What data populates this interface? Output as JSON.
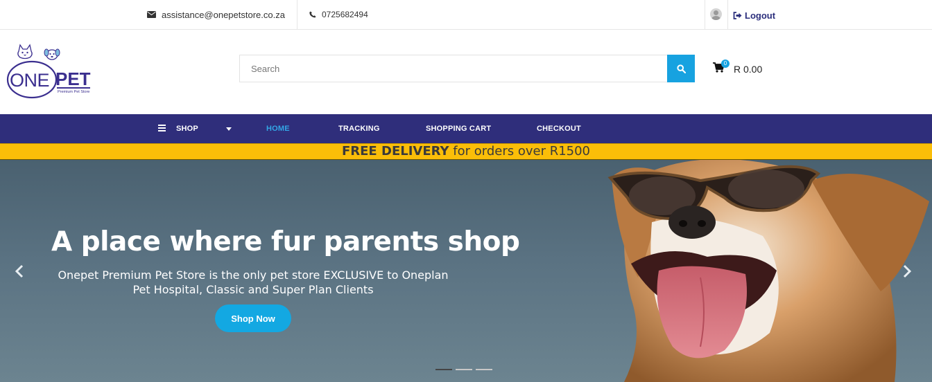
{
  "topbar": {
    "email": "assistance@onepetstore.co.za",
    "phone": "0725682494",
    "logout_label": "Logout",
    "icons": [
      "envelope-icon",
      "phone-icon",
      "user-avatar-icon",
      "sign-out-icon"
    ]
  },
  "logo": {
    "brand_one": "ONE",
    "brand_pet": "PET",
    "tagline": "Premium Pet Store"
  },
  "search": {
    "placeholder": "Search",
    "value": ""
  },
  "cart": {
    "count": "0",
    "total": "R 0.00"
  },
  "nav": {
    "shop": "SHOP",
    "home": "HOME",
    "tracking": "TRACKING",
    "shopping_cart": "SHOPPING CART",
    "checkout": "CHECKOUT",
    "active": "HOME"
  },
  "promo": {
    "bold": "FREE DELIVERY",
    "rest": " for orders over R1500"
  },
  "hero": {
    "title": "A place where fur parents shop",
    "subtitle": "Onepet Premium Pet Store is the only pet store EXCLUSIVE to Oneplan Pet Hospital, Classic and Super Plan Clients",
    "button": "Shop Now",
    "slide_count": 3,
    "active_slide": 1
  },
  "colors": {
    "nav_bg": "#2f2e7b",
    "accent": "#17a2e0",
    "promo_bg": "#fbbe08",
    "brand_purple": "#3b2f8f"
  }
}
